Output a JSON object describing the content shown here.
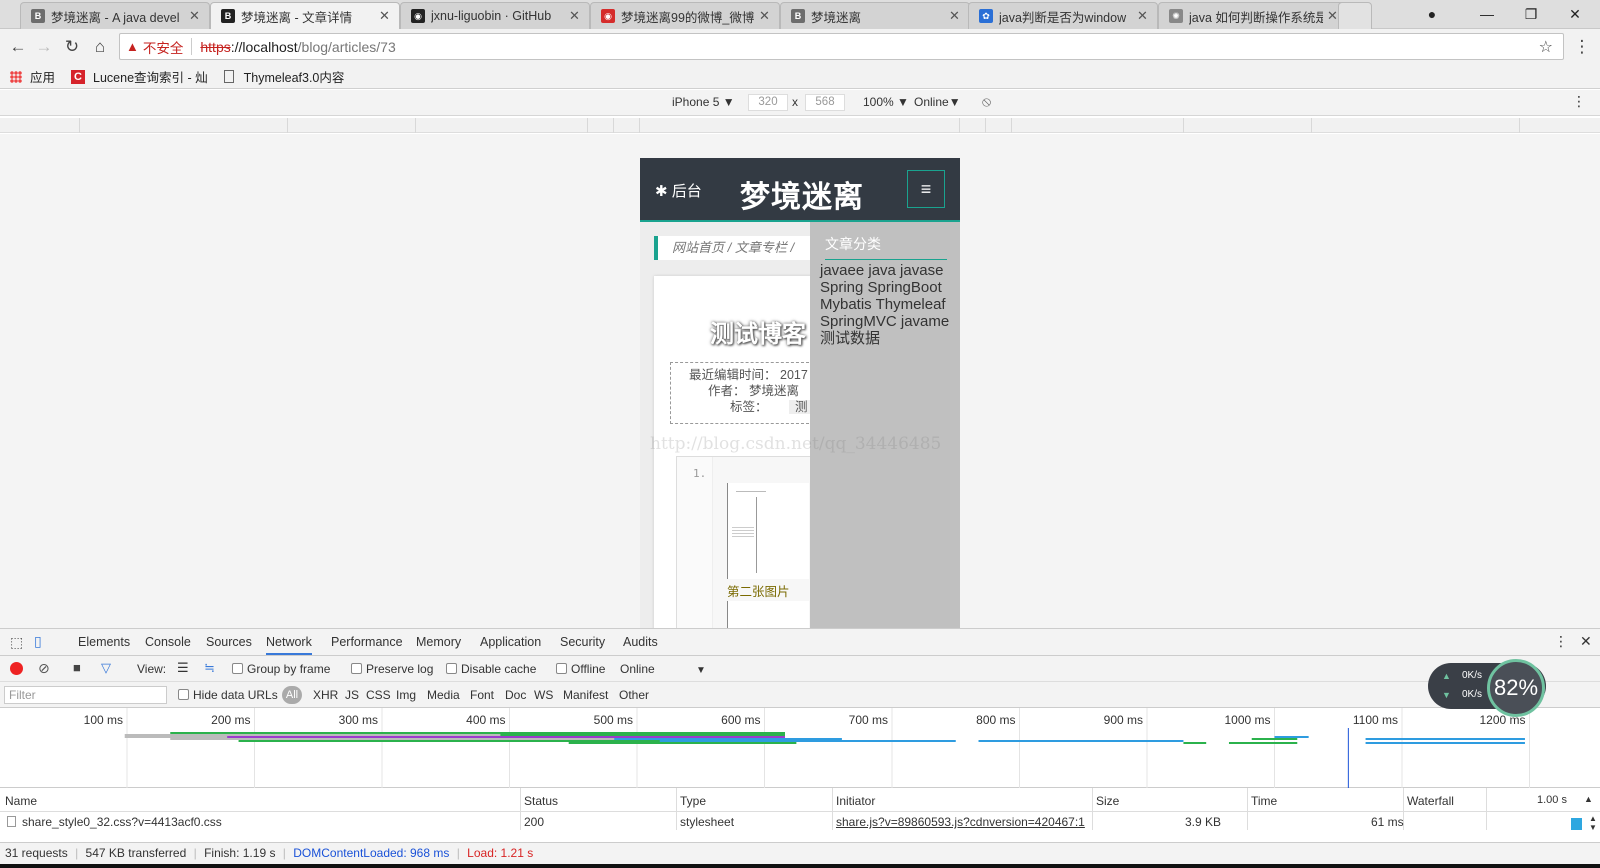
{
  "tabs": [
    {
      "label": "梦境迷离 - A java devel",
      "favicon_text": "B",
      "favicon_color": "#6d6d6d"
    },
    {
      "label": "梦境迷离 - 文章详情",
      "favicon_text": "B",
      "favicon_color": "#222222"
    },
    {
      "label": "jxnu-liguobin · GitHub",
      "favicon_text": "◉",
      "favicon_color": "#222222"
    },
    {
      "label": "梦境迷离99的微博_微博",
      "favicon_text": "◉",
      "favicon_color": "#d52c2b"
    },
    {
      "label": "梦境迷离",
      "favicon_text": "B",
      "favicon_color": "#6d6d6d"
    },
    {
      "label": "java判断是否为window",
      "favicon_text": "✿",
      "favicon_color": "#2a6fd6"
    },
    {
      "label": "java 如何判断操作系统是",
      "favicon_text": "✺",
      "favicon_color": "#888888"
    }
  ],
  "address": {
    "security_label": "不安全",
    "url_scheme": "https",
    "url_host": "://localhost",
    "url_path": "/blog/articles/73"
  },
  "bookmarks": {
    "apps": "应用",
    "lucene": "Lucene查询索引 - 灿",
    "thymeleaf": "Thymeleaf3.0内容"
  },
  "device_toolbar": {
    "device": "iPhone 5",
    "width": "320",
    "height": "568",
    "x_sep": "x",
    "zoom": "100%",
    "network": "Online"
  },
  "site": {
    "admin_label": "后台",
    "title": "梦境迷离",
    "menu_icon": "≡",
    "breadcrumb": "网站首页  /  文章专栏  /",
    "article_title": "测试博客",
    "meta_time_label": "最近编辑时间：",
    "meta_time_value": "2017",
    "meta_author_label": "作者：",
    "meta_author_value": "梦境迷离",
    "meta_tag_label": "标签：",
    "meta_tag_value": "测",
    "code_line_no": "1.",
    "image_caption": "第二张图片",
    "dropdown_title": "文章分类",
    "categories": "javaee java javase Spring SpringBoot Mybatis Thymeleaf SpringMVC javame 测试数据",
    "watermark": "http://blog.csdn.net/qq_34446485"
  },
  "devtools": {
    "tabs": [
      "Elements",
      "Console",
      "Sources",
      "Network",
      "Performance",
      "Memory",
      "Application",
      "Security",
      "Audits"
    ],
    "active_tab": "Network",
    "view_label": "View:",
    "group_by_frame": "Group by frame",
    "preserve_log": "Preserve log",
    "disable_cache": "Disable cache",
    "offline": "Offline",
    "online": "Online",
    "filter_placeholder": "Filter",
    "hide_data_urls": "Hide data URLs",
    "filter_types": [
      "All",
      "XHR",
      "JS",
      "CSS",
      "Img",
      "Media",
      "Font",
      "Doc",
      "WS",
      "Manifest",
      "Other"
    ],
    "timeline_ticks": [
      "100 ms",
      "200 ms",
      "300 ms",
      "400 ms",
      "500 ms",
      "600 ms",
      "700 ms",
      "800 ms",
      "900 ms",
      "1000 ms",
      "1100 ms",
      "1200 ms"
    ],
    "columns": {
      "name": "Name",
      "status": "Status",
      "type": "Type",
      "initiator": "Initiator",
      "size": "Size",
      "time": "Time",
      "waterfall": "Waterfall",
      "waterfall_scale": "1.00 s"
    },
    "rows": [
      {
        "name": "share_style0_32.css?v=4413acf0.css",
        "status": "200",
        "type": "stylesheet",
        "initiator": "share.js?v=89860593.js?cdnversion=420467:1",
        "size": "3.9 KB",
        "time": "61 ms"
      }
    ],
    "summary": {
      "requests": "31 requests",
      "transferred": "547 KB transferred",
      "finish": "Finish: 1.19 s",
      "dom_loaded": "DOMContentLoaded: 968 ms",
      "load": "Load: 1.21 s"
    },
    "speed": {
      "up": "0K/s",
      "down": "0K/s",
      "percent": "82%"
    }
  },
  "colors": {
    "accent_teal": "#1aa38f",
    "dom_blue": "#1a52d8",
    "load_red": "#d82424",
    "record_red": "#e22"
  }
}
